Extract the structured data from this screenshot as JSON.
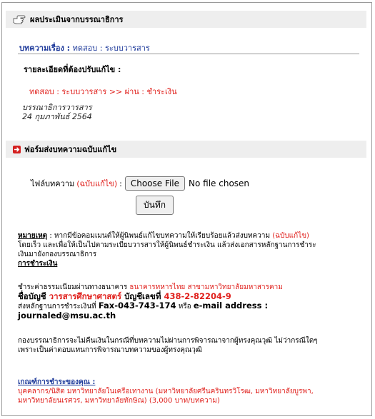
{
  "evaluation": {
    "header_title": "ผลประเมินจากบรรณาธิการ",
    "article_label": "บทความเรื่อง :",
    "article_title": "ทดสอบ : ระบบวารสาร",
    "details_label": "รายละเอียดที่ต้องปรับแก้ไข :",
    "details_text": "ทดสอบ : ระบบวารสาร >> ผ่าน : ชำระเงิน",
    "editor_role": "บรรณาธิการวารสาร",
    "editor_date": "24 กุมภาพันธ์ 2564"
  },
  "submission_form": {
    "header_title": "ฟอร์มส่งบทความฉบับแก้ไข",
    "file_label": "ไฟล์บทความ",
    "file_label_paren": "(ฉบับแก้ไข)",
    "file_label_colon": ":",
    "choose_file_label": "Choose File",
    "no_file_text": "No file chosen",
    "save_label": "บันทึก"
  },
  "remarks": {
    "note_label": "หมายเหตุ",
    "note_text_1": " : หากมีข้อคอมเมนต์ให้ผู้นิพนธ์แก้ไขบทความให้เรียบร้อยแล้วส่งบทความ ",
    "note_text_paren": "(ฉบับแก้ไข)",
    "note_text_2": "โดยเร็ว และเพื่อให้เป็นไปตามระเบียบวารสารให้ผู้นิพนธ์ชำระเงิน แล้วส่งเอกสารหลักฐานการชำระ",
    "note_text_3": "เงินมายังกองบรรณาธิการ",
    "payment_heading": "การชำระเงิน",
    "pay_line_1a": "ชำระค่าธรรมเนียมผ่านทางธนาคาร ",
    "pay_bank": "ธนาคารทหารไทย สาขามหาวิทยาลัยมหาสารคาม",
    "account_name_label": "ชื่อบัญชี ",
    "account_name": "วารสารศึกษาศาสตร์",
    "account_no_label": " บัญชีเลขที่ ",
    "account_no": "438-2-82204-9",
    "proof_line_a": "ส่งหลักฐานการชำระเงินที่ ",
    "fax": "Fax-043-743-174",
    "proof_or": " หรือ ",
    "email_label": "e-mail address :",
    "email": "journaled@msu.ac.th",
    "refund_1": "กองบรรณาธิการจะไม่คืนเงินในกรณีที่บทความไม่ผ่านการพิจารณาจากผู้ทรงคุณวุฒิ ไม่ว่ากรณีใดๆ",
    "refund_2": "เพราะเป็นค่าตอบแทนการพิจารณาบทความของผู้ทรงคุณวุฒิ",
    "criteria_heading": "เกณฑ์การชำระของคุณ :",
    "criteria_1": "บุคคลากร/นิสิต มหาวิทยาลัยในเครือเทางาน (มหาวิทยาลัยศรีนครินทรวิโรฒ, มหาวิทยาลัยบูรพา,",
    "criteria_2": "มหาวิทยาลัยนเรศวร, มหาวิทยาลัยทักษิณ) (3,000 บาท/บทความ)"
  }
}
